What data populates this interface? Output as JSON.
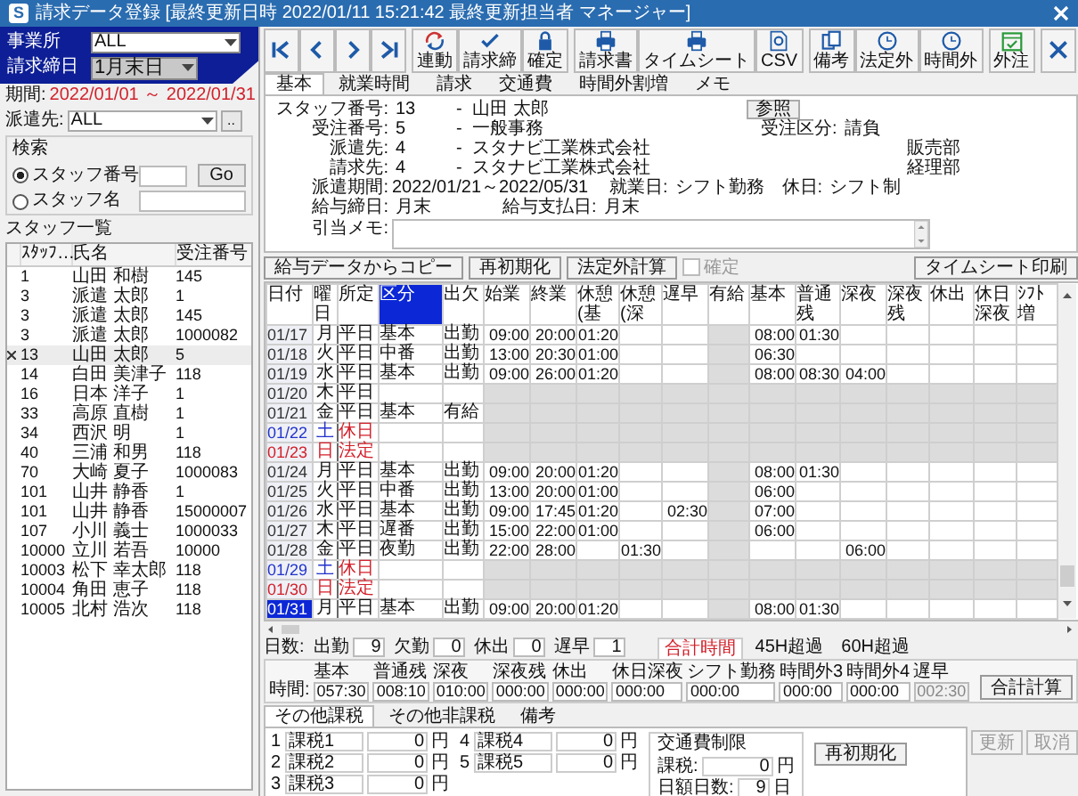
{
  "window": {
    "logo": "S",
    "title": "請求データ登録 [最終更新日時 2022/01/11 15:21:42 最終更新担当者 マネージャー]"
  },
  "header": {
    "office_label": "事業所",
    "office": "ALL",
    "closing_label": "請求締日",
    "closing": "1月末日"
  },
  "toolbar": {
    "groups": [
      [
        "連動",
        "請求締",
        "確定"
      ],
      [
        "請求書",
        "タイムシート",
        "CSV"
      ],
      [
        "備考",
        "法定外",
        "時間外"
      ],
      [
        "外注"
      ]
    ]
  },
  "side": {
    "period_label": "期間:",
    "period": "2022/01/01 ～ 2022/01/31",
    "dispatch_label": "派遣先:",
    "dispatch": "ALL",
    "more": "..",
    "search": {
      "title": "検索",
      "options": [
        {
          "label": "スタッフ番号",
          "selected": true
        },
        {
          "label": "スタッフ名",
          "selected": false
        }
      ],
      "go": "Go"
    },
    "list_title": "スタッフ一覧",
    "columns": [
      "ｽﾀｯﾌ…",
      "氏名",
      "受注番号"
    ],
    "rows": [
      {
        "no": "1",
        "name": "山田 和樹",
        "order": "145",
        "selected": false
      },
      {
        "no": "3",
        "name": "派遣 太郎",
        "order": "1",
        "selected": false
      },
      {
        "no": "3",
        "name": "派遣 太郎",
        "order": "145",
        "selected": false
      },
      {
        "no": "3",
        "name": "派遣 太郎",
        "order": "1000082",
        "selected": false
      },
      {
        "no": "13",
        "name": "山田 太郎",
        "order": "5",
        "selected": true
      },
      {
        "no": "14",
        "name": "白田 美津子",
        "order": "118",
        "selected": false
      },
      {
        "no": "16",
        "name": "日本 洋子",
        "order": "1",
        "selected": false
      },
      {
        "no": "33",
        "name": "高原 直樹",
        "order": "1",
        "selected": false
      },
      {
        "no": "34",
        "name": "西沢 明",
        "order": "1",
        "selected": false
      },
      {
        "no": "40",
        "name": "三浦 和男",
        "order": "118",
        "selected": false
      },
      {
        "no": "70",
        "name": "大崎 夏子",
        "order": "1000083",
        "selected": false
      },
      {
        "no": "101",
        "name": "山井 静香",
        "order": "1",
        "selected": false
      },
      {
        "no": "101",
        "name": "山井 静香",
        "order": "15000007",
        "selected": false
      },
      {
        "no": "107",
        "name": "小川 義士",
        "order": "1000033",
        "selected": false
      },
      {
        "no": "10000",
        "name": "立川 若吾",
        "order": "10000",
        "selected": false
      },
      {
        "no": "10003",
        "name": "松下 幸太郎",
        "order": "118",
        "selected": false
      },
      {
        "no": "10004",
        "name": "角田 恵子",
        "order": "118",
        "selected": false
      },
      {
        "no": "10005",
        "name": "北村 浩次",
        "order": "118",
        "selected": false
      }
    ]
  },
  "tabs": [
    {
      "label": "基本",
      "selected": true
    },
    {
      "label": "就業時間",
      "selected": false
    },
    {
      "label": "請求",
      "selected": false
    },
    {
      "label": "交通費",
      "selected": false
    },
    {
      "label": "時間外割増",
      "selected": false
    },
    {
      "label": "メモ",
      "selected": false
    }
  ],
  "form": {
    "staff": {
      "label": "スタッフ番号:",
      "number": "13",
      "dash": "-",
      "name": "山田 太郎",
      "button": "参照"
    },
    "order": {
      "label": "受注番号:",
      "number": "5",
      "dash": "-",
      "name": "一般事務",
      "type_label": "受注区分:",
      "type": "請負"
    },
    "dispatch": {
      "label": "派遣先:",
      "number": "4",
      "dash": "-",
      "name": "スタナビ工業株式会社",
      "dept": "販売部"
    },
    "billing": {
      "label": "請求先:",
      "number": "4",
      "dash": "-",
      "name": "スタナビ工業株式会社",
      "dept": "経理部"
    },
    "period": {
      "label": "派遣期間:",
      "value": "2022/01/21～2022/05/31",
      "workday_label": "就業日:",
      "workday": "シフト勤務",
      "holiday_label": "休日:",
      "holiday": "シフト制"
    },
    "pay": {
      "closing_label": "給与締日:",
      "closing": "月末",
      "payday_label": "給与支払日:",
      "payday": "月末"
    },
    "memo_label": "引当メモ:"
  },
  "actions": {
    "buttons": [
      "給与データからコピー",
      "再初期化",
      "法定外計算"
    ],
    "confirm": {
      "label": "確定",
      "checked": false,
      "disabled": true
    },
    "print": "タイムシート印刷"
  },
  "table": {
    "columns": [
      {
        "label": "日付",
        "selected": false
      },
      {
        "label": "曜日",
        "selected": false
      },
      {
        "label": "所定",
        "selected": false
      },
      {
        "label": "区分",
        "selected": true
      },
      {
        "label": "出欠",
        "selected": false
      },
      {
        "label": "始業",
        "selected": false
      },
      {
        "label": "終業",
        "selected": false
      },
      {
        "label": "休憩(基",
        "selected": false
      },
      {
        "label": "休憩(深",
        "selected": false
      },
      {
        "label": "遅早",
        "selected": false
      },
      {
        "label": "有給",
        "selected": false
      },
      {
        "label": "基本",
        "selected": false
      },
      {
        "label": "普通残",
        "selected": false
      },
      {
        "label": "深夜",
        "selected": false
      },
      {
        "label": "深夜残",
        "selected": false
      },
      {
        "label": "休出",
        "selected": false
      },
      {
        "label": "休日深夜",
        "selected": false
      },
      {
        "label": "ｼﾌﾄ増",
        "selected": false
      }
    ],
    "rows": [
      {
        "kind": "weekday",
        "selected": false,
        "cells": [
          "01/17",
          "月",
          "平日",
          "基本",
          "出勤",
          "09:00",
          "20:00",
          "01:20",
          null,
          null,
          null,
          "08:00",
          "01:30",
          null,
          null,
          null,
          null,
          null
        ]
      },
      {
        "kind": "weekday",
        "selected": false,
        "cells": [
          "01/18",
          "火",
          "平日",
          "中番",
          "出勤",
          "13:00",
          "20:30",
          "01:00",
          null,
          null,
          null,
          "06:30",
          null,
          null,
          null,
          null,
          null,
          null
        ]
      },
      {
        "kind": "weekday",
        "selected": false,
        "cells": [
          "01/19",
          "水",
          "平日",
          "基本",
          "出勤",
          "09:00",
          "26:00",
          "01:20",
          null,
          null,
          null,
          "08:00",
          "08:30",
          "04:00",
          null,
          null,
          null,
          null
        ]
      },
      {
        "kind": "weekday",
        "selected": false,
        "cells": [
          "01/20",
          "木",
          "平日",
          null,
          null,
          null,
          null,
          null,
          null,
          null,
          null,
          null,
          null,
          null,
          null,
          null,
          null,
          null
        ]
      },
      {
        "kind": "weekday",
        "selected": false,
        "cells": [
          "01/21",
          "金",
          "平日",
          "基本",
          "有給",
          null,
          null,
          null,
          null,
          null,
          null,
          null,
          null,
          null,
          null,
          null,
          null,
          null
        ]
      },
      {
        "kind": "saturday",
        "selected": false,
        "cells": [
          "01/22",
          "土",
          "休日",
          null,
          null,
          null,
          null,
          null,
          null,
          null,
          null,
          null,
          null,
          null,
          null,
          null,
          null,
          null
        ]
      },
      {
        "kind": "sunday",
        "selected": false,
        "cells": [
          "01/23",
          "日",
          "法定",
          null,
          null,
          null,
          null,
          null,
          null,
          null,
          null,
          null,
          null,
          null,
          null,
          null,
          null,
          null
        ]
      },
      {
        "kind": "weekday",
        "selected": false,
        "cells": [
          "01/24",
          "月",
          "平日",
          "基本",
          "出勤",
          "09:00",
          "20:00",
          "01:20",
          null,
          null,
          null,
          "08:00",
          "01:30",
          null,
          null,
          null,
          null,
          null
        ]
      },
      {
        "kind": "weekday",
        "selected": false,
        "cells": [
          "01/25",
          "火",
          "平日",
          "中番",
          "出勤",
          "13:00",
          "20:00",
          "01:00",
          null,
          null,
          null,
          "06:00",
          null,
          null,
          null,
          null,
          null,
          null
        ]
      },
      {
        "kind": "weekday",
        "selected": false,
        "cells": [
          "01/26",
          "水",
          "平日",
          "基本",
          "出勤",
          "09:00",
          "17:45",
          "01:20",
          null,
          "02:30",
          null,
          "07:00",
          null,
          null,
          null,
          null,
          null,
          null
        ]
      },
      {
        "kind": "weekday",
        "selected": false,
        "cells": [
          "01/27",
          "木",
          "平日",
          "遅番",
          "出勤",
          "15:00",
          "22:00",
          "01:00",
          null,
          null,
          null,
          "06:00",
          null,
          null,
          null,
          null,
          null,
          null
        ]
      },
      {
        "kind": "weekday",
        "selected": false,
        "cells": [
          "01/28",
          "金",
          "平日",
          "夜勤",
          "出勤",
          "22:00",
          "28:00",
          null,
          "01:30",
          null,
          null,
          null,
          null,
          "06:00",
          null,
          null,
          null,
          null
        ]
      },
      {
        "kind": "saturday",
        "selected": false,
        "cells": [
          "01/29",
          "土",
          "休日",
          null,
          null,
          null,
          null,
          null,
          null,
          null,
          null,
          null,
          null,
          null,
          null,
          null,
          null,
          null
        ]
      },
      {
        "kind": "sunday",
        "selected": false,
        "cells": [
          "01/30",
          "日",
          "法定",
          null,
          null,
          null,
          null,
          null,
          null,
          null,
          null,
          null,
          null,
          null,
          null,
          null,
          null,
          null
        ]
      },
      {
        "kind": "weekday",
        "selected": true,
        "cells": [
          "01/31",
          "月",
          "平日",
          "基本",
          "出勤",
          "09:00",
          "20:00",
          "01:20",
          null,
          null,
          null,
          "08:00",
          "01:30",
          null,
          null,
          null,
          null,
          null
        ]
      }
    ]
  },
  "summary": {
    "tabs": [
      {
        "label": "合計時間",
        "selected": true
      },
      {
        "label": "45H超過",
        "selected": false
      },
      {
        "label": "60H超過",
        "selected": false
      }
    ],
    "days_label": "日数:",
    "days": [
      {
        "label": "出勤",
        "value": "9"
      },
      {
        "label": "欠勤",
        "value": "0"
      },
      {
        "label": "休出",
        "value": "0"
      },
      {
        "label": "遅早",
        "value": "1"
      }
    ],
    "hours_label": "時間:",
    "hours": [
      {
        "label": "基本",
        "value": "057:30",
        "disabled": false
      },
      {
        "label": "普通残",
        "value": "008:10",
        "disabled": false
      },
      {
        "label": "深夜",
        "value": "010:00",
        "disabled": false
      },
      {
        "label": "深夜残",
        "value": "000:00",
        "disabled": false
      },
      {
        "label": "休出",
        "value": "000:00",
        "disabled": false
      },
      {
        "label": "休日深夜",
        "value": "000:00",
        "disabled": false
      },
      {
        "label": "シフト勤務",
        "value": "000:00",
        "disabled": false
      },
      {
        "label": "時間外3",
        "value": "000:00",
        "disabled": false
      },
      {
        "label": "時間外4",
        "value": "000:00",
        "disabled": false
      },
      {
        "label": "遅早",
        "value": "002:30",
        "disabled": true
      }
    ],
    "button": "合計計算"
  },
  "extra": {
    "tabs": [
      {
        "label": "その他課税",
        "selected": true
      },
      {
        "label": "その他非課税",
        "selected": false
      },
      {
        "label": "備考",
        "selected": false
      }
    ],
    "items": [
      {
        "no": "1",
        "name": "課税1",
        "amount": "0",
        "unit": "円"
      },
      {
        "no": "2",
        "name": "課税2",
        "amount": "0",
        "unit": "円"
      },
      {
        "no": "3",
        "name": "課税3",
        "amount": "0",
        "unit": "円"
      },
      {
        "no": "4",
        "name": "課税4",
        "amount": "0",
        "unit": "円"
      },
      {
        "no": "5",
        "name": "課税5",
        "amount": "0",
        "unit": "円"
      }
    ],
    "transport": {
      "title": "交通費制限",
      "tax_label": "課税:",
      "tax": "0",
      "tax_unit": "円",
      "days_label": "日額日数:",
      "days": "9",
      "days_unit": "日"
    },
    "reinit": "再初期化"
  },
  "commands": [
    {
      "label": "更新",
      "disabled": true
    },
    {
      "label": "取消",
      "disabled": true
    }
  ]
}
